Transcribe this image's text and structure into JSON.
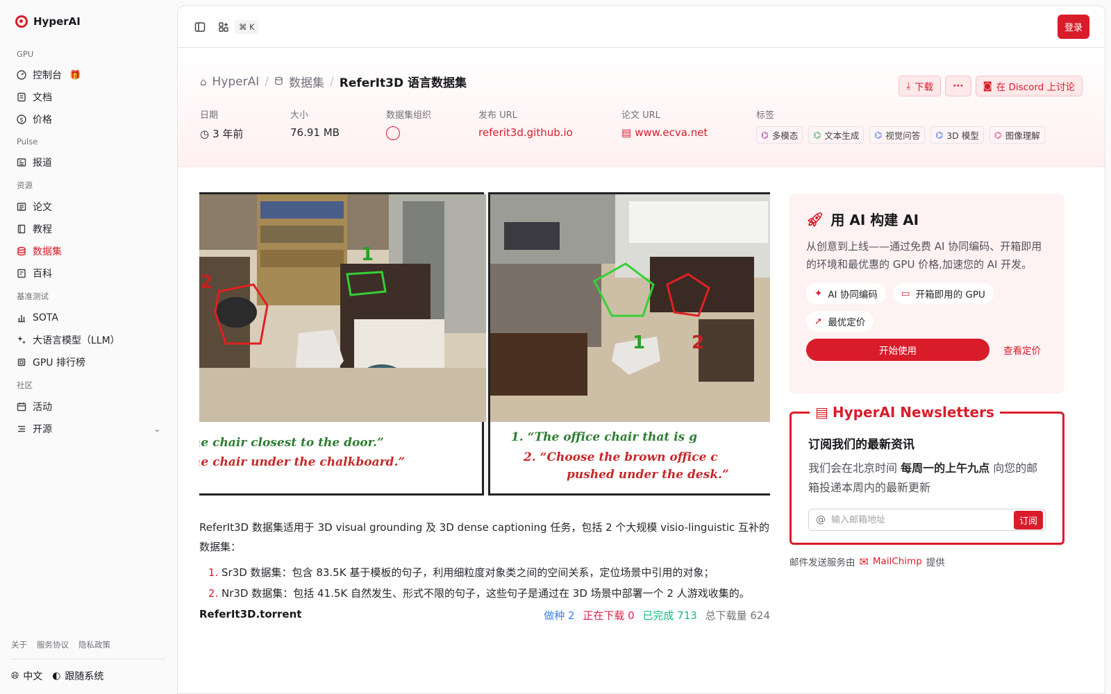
{
  "brand": "HyperAI",
  "sidebar": {
    "sections": [
      {
        "title": "GPU",
        "items": [
          {
            "label": "控制台",
            "icon": "dashboard-icon"
          },
          {
            "label": "文档",
            "icon": "document-icon"
          },
          {
            "label": "价格",
            "icon": "dollar-icon"
          }
        ]
      },
      {
        "title": "Pulse",
        "items": [
          {
            "label": "报道",
            "icon": "news-icon"
          }
        ]
      },
      {
        "title": "资源",
        "items": [
          {
            "label": "论文",
            "icon": "paper-icon"
          },
          {
            "label": "教程",
            "icon": "book-icon"
          },
          {
            "label": "数据集",
            "icon": "database-icon",
            "active": true
          },
          {
            "label": "百科",
            "icon": "encyclopedia-icon"
          }
        ]
      },
      {
        "title": "基准测试",
        "items": [
          {
            "label": "SOTA",
            "icon": "bar-chart-icon"
          },
          {
            "label": "大语言模型（LLM）",
            "icon": "sparkle-icon"
          },
          {
            "label": "GPU 排行榜",
            "icon": "cpu-icon"
          }
        ]
      },
      {
        "title": "社区",
        "items": [
          {
            "label": "活动",
            "icon": "calendar-icon"
          },
          {
            "label": "开源",
            "icon": "list-icon"
          }
        ]
      }
    ],
    "footer_links": [
      "关于",
      "服务协议",
      "隐私政策"
    ],
    "language": "中文",
    "theme": "跟随系统"
  },
  "topbar": {
    "shortcut": "⌘ K",
    "login": "登录"
  },
  "breadcrumb": {
    "home": "HyperAI",
    "section": "数据集",
    "current": "ReferIt3D 语言数据集"
  },
  "actions": {
    "download": "下载",
    "more": "···",
    "discord": "在 Discord 上讨论"
  },
  "meta": {
    "date_label": "日期",
    "date": "3 年前",
    "size_label": "大小",
    "size": "76.91 MB",
    "org_label": "数据集组织",
    "url_label": "发布 URL",
    "url": "referit3d.github.io",
    "paper_label": "论文 URL",
    "paper": "www.ecva.net",
    "tags_label": "标签",
    "tags": [
      {
        "label": "多模态",
        "color": "#a21caf"
      },
      {
        "label": "文本生成",
        "color": "#16a34a"
      },
      {
        "label": "视觉问答",
        "color": "#2563eb"
      },
      {
        "label": "3D 模型",
        "color": "#2563eb"
      },
      {
        "label": "图像理解",
        "color": "#db2777"
      }
    ]
  },
  "figure": {
    "left_captions": [
      "he chair closest to the door.”",
      "he chair under the chalkboard.”"
    ],
    "right_captions": [
      "1. “The office chair that is g",
      "2. “Choose the brown office c",
      "pushed under the desk.”"
    ],
    "left_labels": [
      "2",
      "1"
    ],
    "right_labels": [
      "1",
      "2"
    ]
  },
  "description": "ReferIt3D 数据集适用于 3D visual grounding 及 3D dense captioning 任务，包括 2 个大规模 visio-linguistic 互补的数据集：",
  "list": [
    "Sr3D 数据集：包含 83.5K 基于模板的句子，利用细粒度对象类之间的空间关系，定位场景中引用的对象；",
    "Nr3D 数据集：包括 41.5K 自然发生、形式不限的句子，这些句子是通过在 3D 场景中部署一个 2 人游戏收集的。"
  ],
  "torrent": {
    "name": "ReferIt3D.torrent",
    "seeding": "做种 2",
    "downloading": "正在下载 0",
    "completed": "已完成 713",
    "total": "总下载量 624"
  },
  "promo": {
    "title": "用 AI 构建 AI",
    "desc": "从创意到上线——通过免费 AI 协同编码、开箱即用的环境和最优惠的 GPU 价格,加速您的 AI 开发。",
    "chips": [
      "AI 协同编码",
      "开箱即用的 GPU",
      "最优定价"
    ],
    "start": "开始使用",
    "pricing": "查看定价"
  },
  "newsletter": {
    "title": "HyperAI Newsletters",
    "subtitle": "订阅我们的最新资讯",
    "text_pre": "我们会在北京时间 ",
    "text_bold": "每周一的上午九点",
    "text_post": " 向您的邮箱投递本周内的最新更新",
    "placeholder": "输入邮箱地址",
    "button": "订阅",
    "mail_pre": "邮件发送服务由",
    "mail_brand": "MailChimp",
    "mail_post": "提供"
  },
  "colors": {
    "accent": "#d91c2a",
    "seed": "#3b82f6",
    "downloading": "#e11d48",
    "completed": "#10b981"
  }
}
